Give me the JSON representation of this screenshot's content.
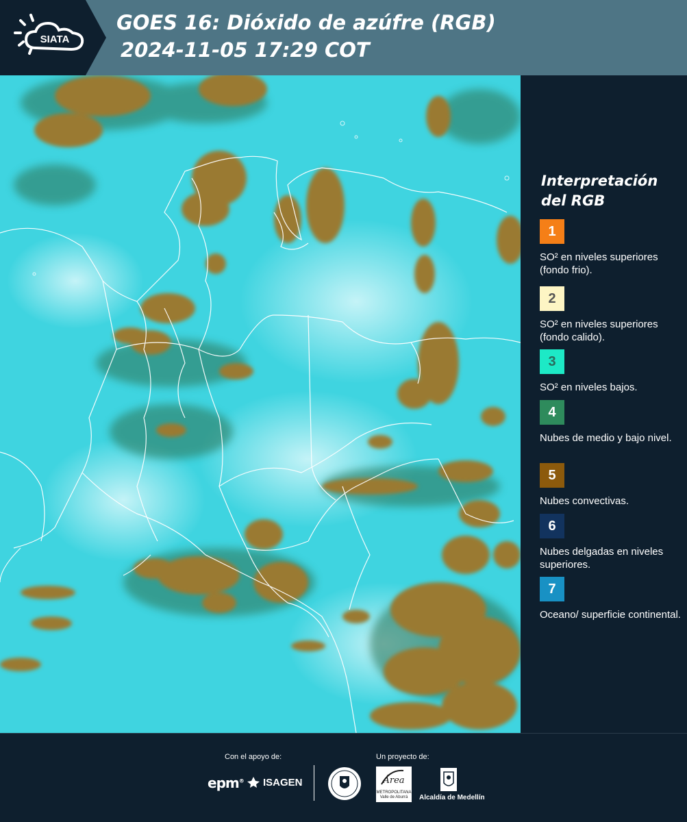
{
  "header": {
    "logo_text": "SIATA",
    "title_line1": "GOES 16: Dióxido de azúfre (RGB)",
    "title_line2": " 2024-11-05 17:29 COT"
  },
  "legend": {
    "title_line1": "Interpretación",
    "title_line2": "del RGB",
    "items": [
      {
        "number": "1",
        "color": "#f57f17",
        "number_color": "#ffffff",
        "text": "SO² en niveles superiores (fondo frio)."
      },
      {
        "number": "2",
        "color": "#fdf5c4",
        "number_color": "#555555",
        "text": "SO² en niveles superiores (fondo calido)."
      },
      {
        "number": "3",
        "color": "#1de9c6",
        "number_color": "#2a6b5c",
        "text": "SO² en niveles bajos."
      },
      {
        "number": "4",
        "color": "#2e8b5c",
        "number_color": "#ffffff",
        "text": "Nubes de medio y bajo nivel."
      },
      {
        "number": "5",
        "color": "#8c5a0c",
        "number_color": "#ffffff",
        "text": "Nubes convectivas."
      },
      {
        "number": "6",
        "color": "#12335e",
        "number_color": "#ffffff",
        "text": "Nubes delgadas en niveles superiores."
      },
      {
        "number": "7",
        "color": "#1891c4",
        "number_color": "#ffffff",
        "text": "Oceano/ superficie continental."
      }
    ]
  },
  "footer": {
    "support_label": "Con el apoyo de:",
    "project_label": "Un proyecto de:",
    "epm_label": "epm",
    "isagen_label": "ISAGEN",
    "area_label": "Área",
    "area_sub": "METROPOLITANA Valle de Aburrá",
    "alcaldia_label": "Alcaldía de Medellín"
  },
  "colors": {
    "header_bg": "#4e7585",
    "panel_bg": "#0e1f2e",
    "map_base": "#3fd4e0",
    "cloud": "#9a7a32"
  }
}
